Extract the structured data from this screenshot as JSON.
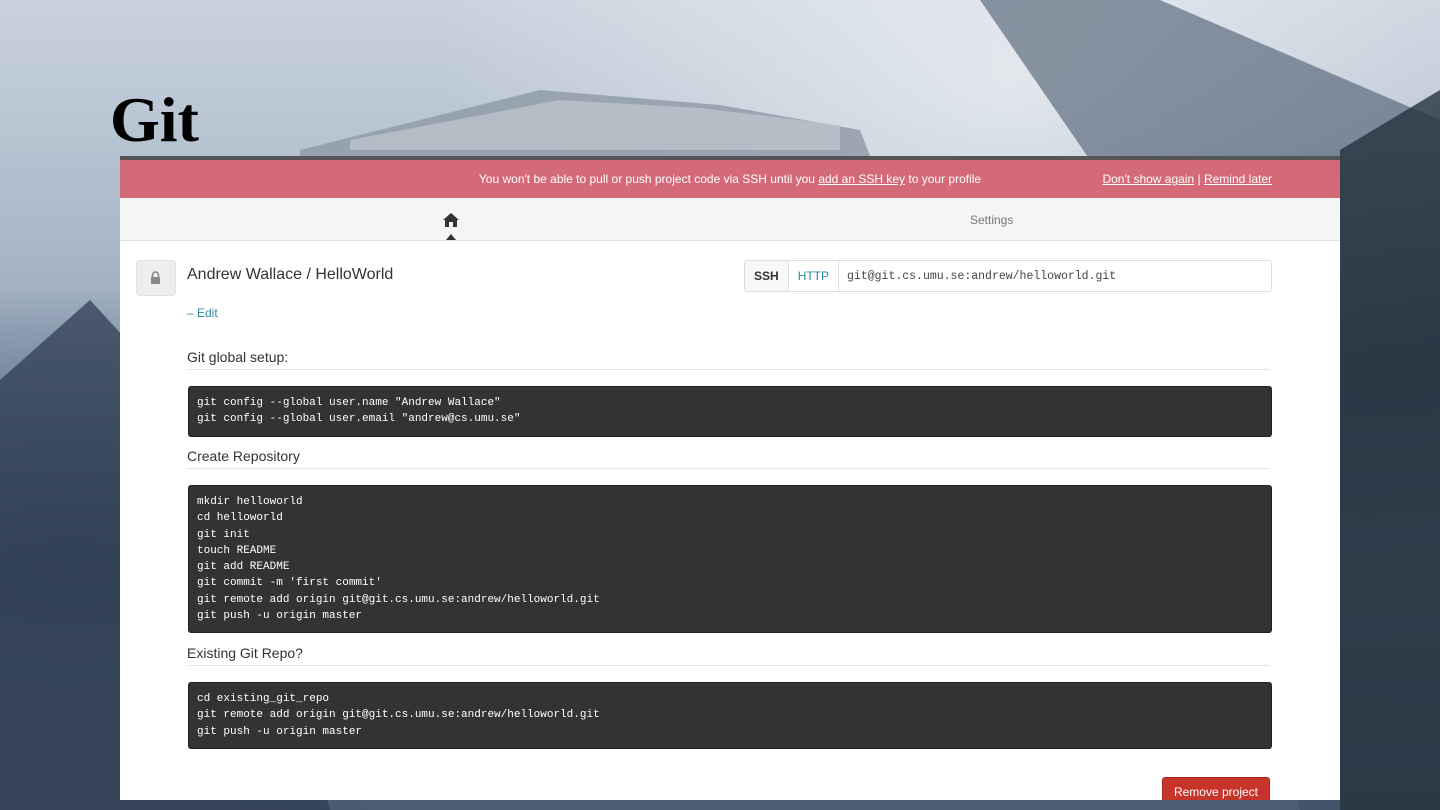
{
  "slide": {
    "title": "Git"
  },
  "alert": {
    "message_before": "You won't be able to pull or push project code via SSH until you",
    "link": "add an SSH key",
    "message_after": "to your profile",
    "dont_show": "Don't show again",
    "separator": "|",
    "remind": "Remind later",
    "color": "#d46a78"
  },
  "nav": {
    "home_icon": "home-icon",
    "settings": "Settings"
  },
  "project": {
    "lock_icon": "lock-icon",
    "title": "Andrew Wallace / HelloWorld",
    "edit": "– Edit"
  },
  "clone": {
    "ssh": "SSH",
    "http": "HTTP",
    "url": "git@git.cs.umu.se:andrew/helloworld.git"
  },
  "sections": [
    {
      "heading": "Git global setup:",
      "code": "git config --global user.name \"Andrew Wallace\"\ngit config --global user.email \"andrew@cs.umu.se\""
    },
    {
      "heading": "Create Repository",
      "code": "mkdir helloworld\ncd helloworld\ngit init\ntouch README\ngit add README\ngit commit -m 'first commit'\ngit remote add origin git@git.cs.umu.se:andrew/helloworld.git\ngit push -u origin master"
    },
    {
      "heading": "Existing Git Repo?",
      "code": "cd existing_git_repo\ngit remote add origin git@git.cs.umu.se:andrew/helloworld.git\ngit push -u origin master"
    }
  ],
  "remove_button": "Remove project"
}
